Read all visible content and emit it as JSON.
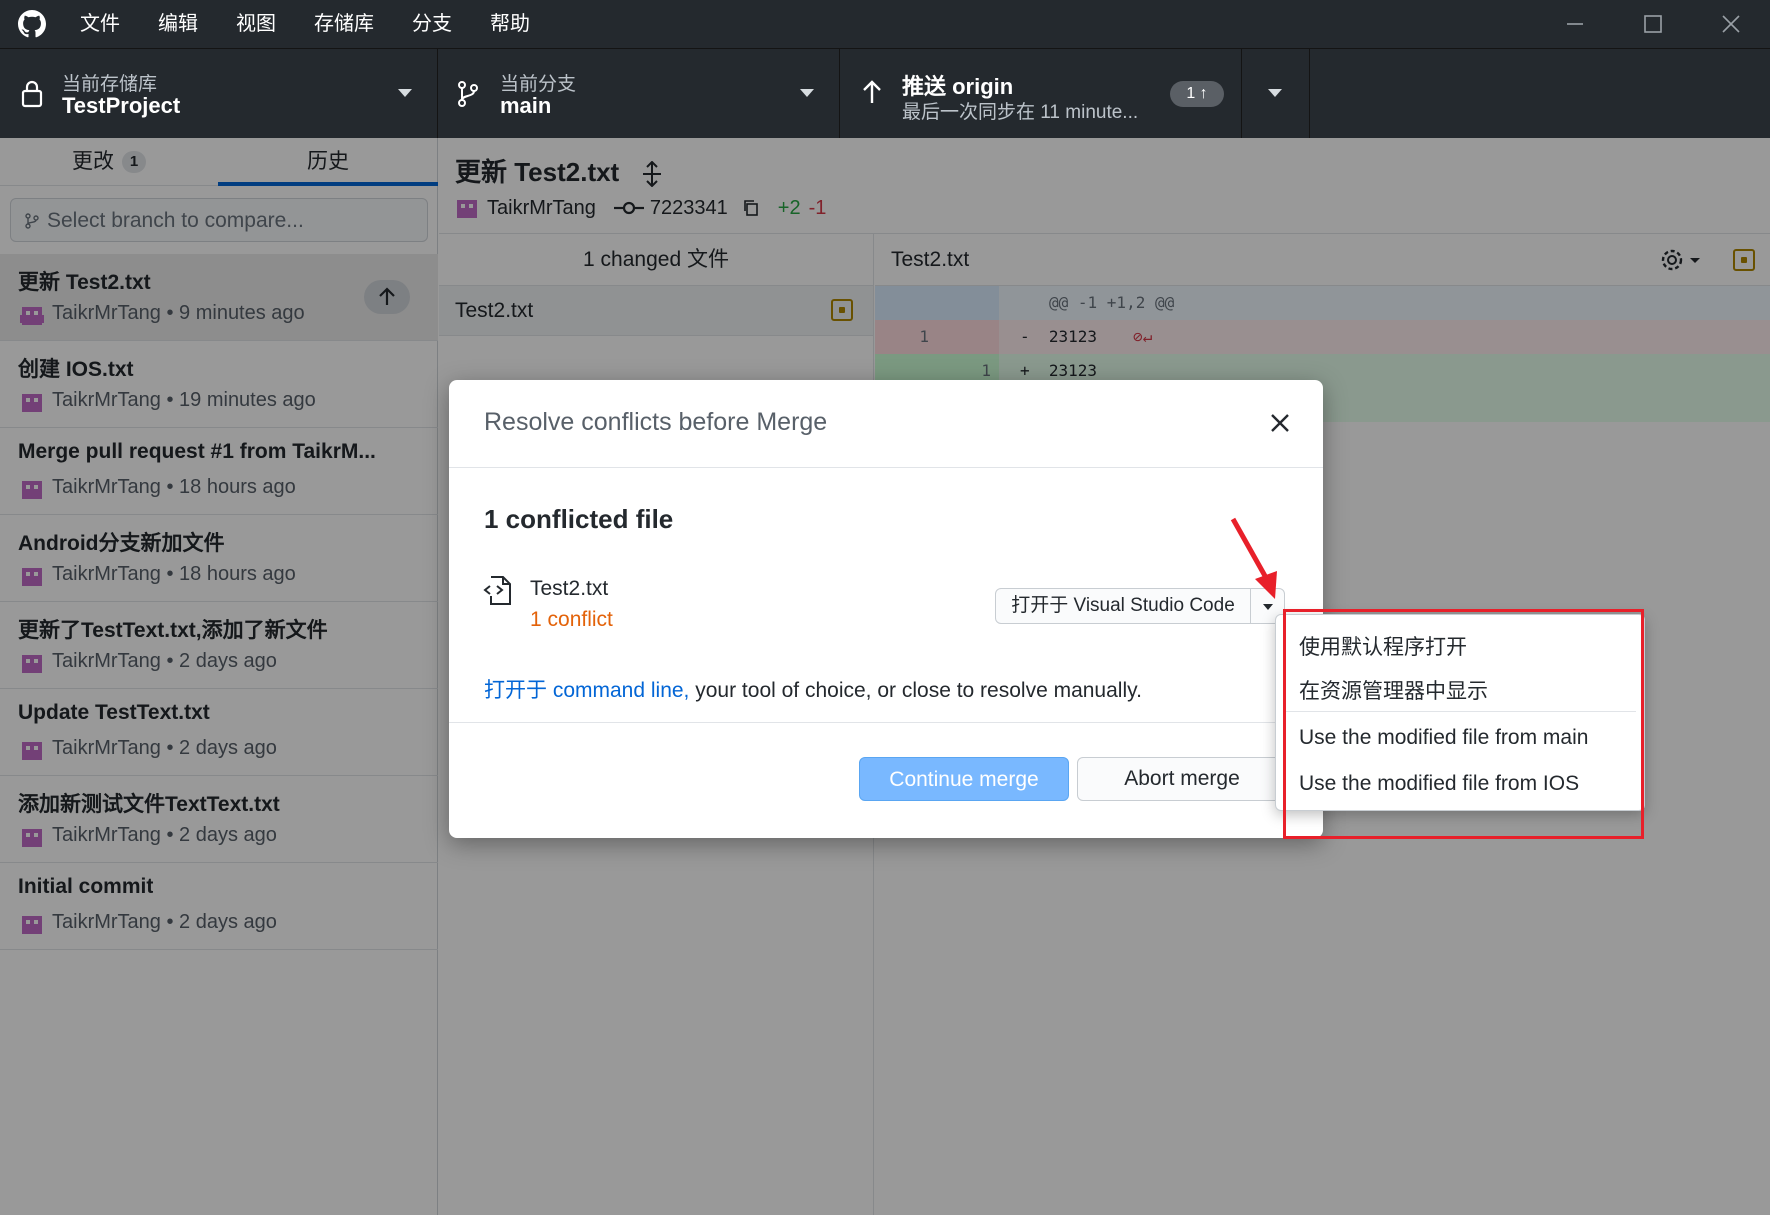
{
  "menu": [
    "文件",
    "编辑",
    "视图",
    "存储库",
    "分支",
    "帮助"
  ],
  "toolbar": {
    "repo_caption": "当前存储库",
    "repo_name": "TestProject",
    "branch_caption": "当前分支",
    "branch_name": "main",
    "push_title": "推送 origin",
    "push_sub": "最后一次同步在 11 minute...",
    "push_count": "1 ↑"
  },
  "sidebar": {
    "tab_changes": "更改",
    "tab_changes_count": "1",
    "tab_history": "历史",
    "compare_placeholder": "Select branch to compare...",
    "commits": [
      {
        "title": "更新 Test2.txt",
        "meta": "TaikrMrTang • 9 minutes ago"
      },
      {
        "title": "创建 IOS.txt",
        "meta": "TaikrMrTang • 19 minutes ago"
      },
      {
        "title": "Merge pull request #1 from TaikrM...",
        "meta": "TaikrMrTang • 18 hours ago"
      },
      {
        "title": "Android分支新加文件",
        "meta": "TaikrMrTang • 18 hours ago"
      },
      {
        "title": "更新了TestText.txt,添加了新文件",
        "meta": "TaikrMrTang • 2 days ago"
      },
      {
        "title": "Update TestText.txt",
        "meta": "TaikrMrTang • 2 days ago"
      },
      {
        "title": "添加新测试文件TextText.txt",
        "meta": "TaikrMrTang • 2 days ago"
      },
      {
        "title": "Initial commit",
        "meta": "TaikrMrTang • 2 days ago"
      }
    ]
  },
  "commit_view": {
    "title": "更新 Test2.txt",
    "author": "TaikrMrTang",
    "sha": "7223341",
    "added": "+2",
    "removed": "-1",
    "changed_files": "1 changed 文件",
    "file": "Test2.txt",
    "diff_file": "Test2.txt",
    "hunk": "@@ -1 +1,2 @@",
    "del_line_no": "1",
    "del_text": "-  23123",
    "add_line_no": "1",
    "add_text": "+  23123"
  },
  "dialog": {
    "title": "Resolve conflicts before Merge",
    "heading": "1 conflicted file",
    "file_name": "Test2.txt",
    "conflict_text": "1 conflict",
    "open_button": "打开于 Visual Studio Code",
    "hint_link": "打开于 command line,",
    "hint_rest": " your tool of choice, or close to resolve manually.",
    "continue_button": "Continue merge",
    "abort_button": "Abort merge"
  },
  "dropdown": {
    "items": [
      "使用默认程序打开",
      "在资源管理器中显示",
      "Use the modified file from main",
      "Use the modified file from IOS"
    ]
  },
  "colors": {
    "titlebar": "#24292e",
    "accent": "#0366d6",
    "conflict": "#e36209",
    "annotation": "#e8202a"
  }
}
